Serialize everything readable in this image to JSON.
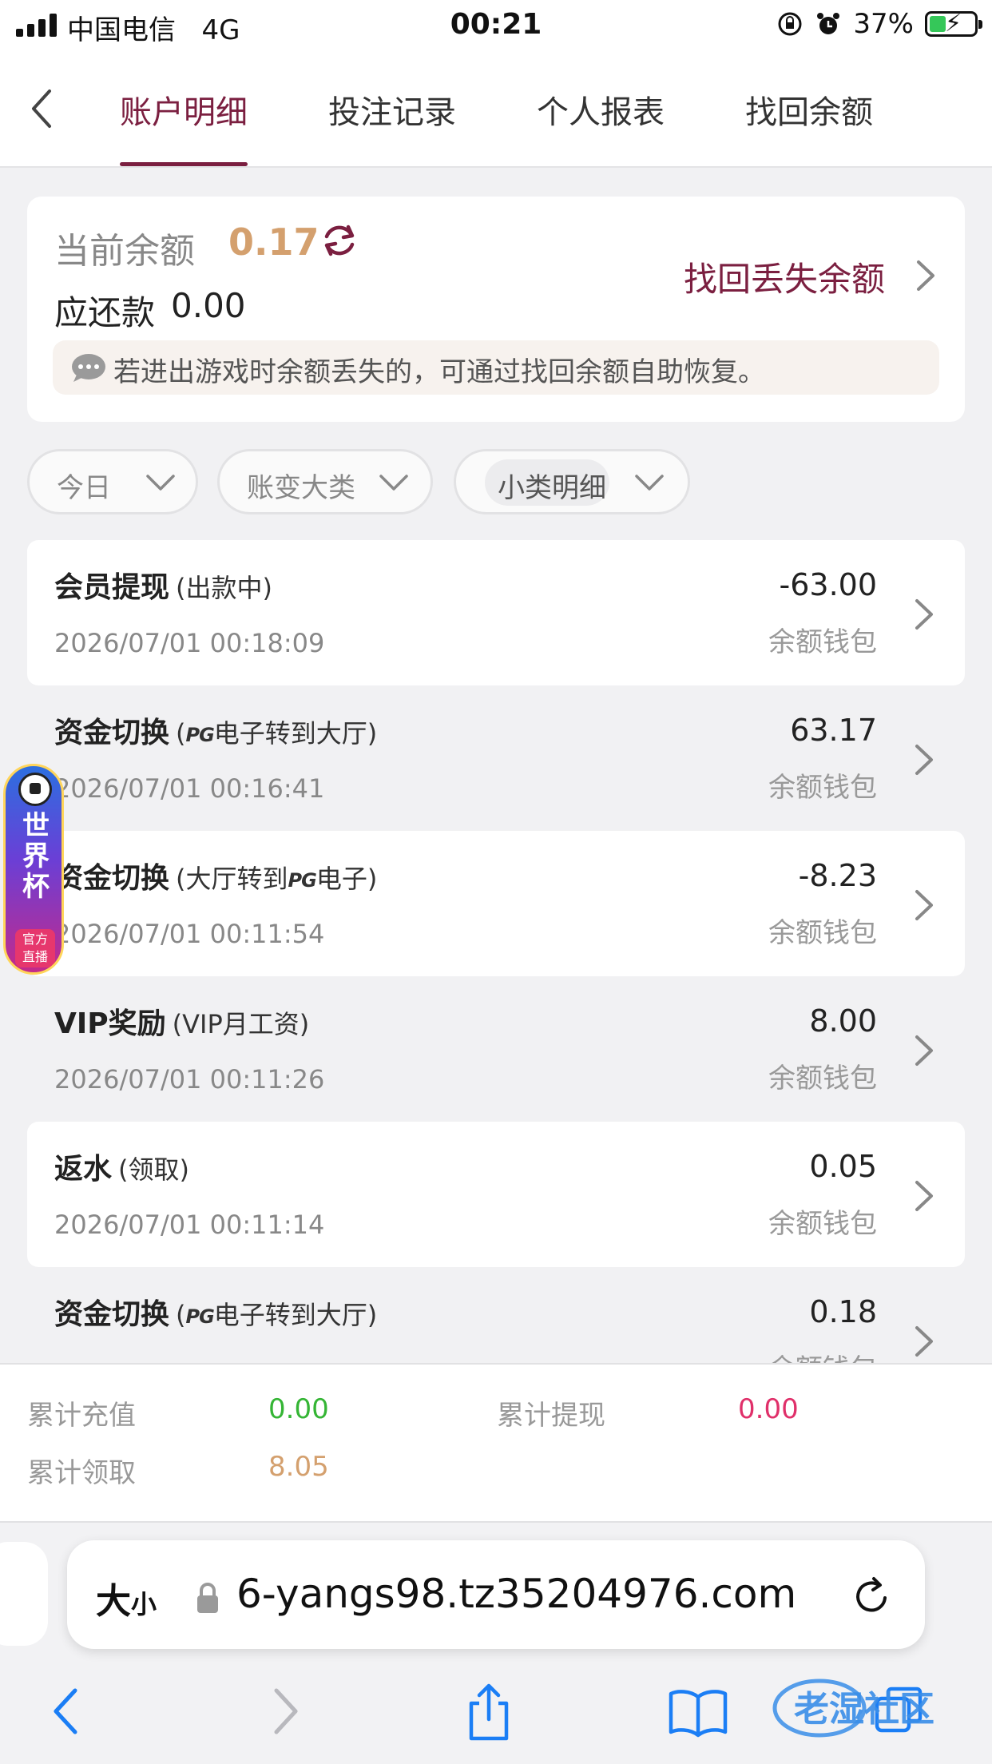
{
  "status_bar": {
    "carrier": "中国电信",
    "network": "4G",
    "time": "00:21",
    "battery": "37%",
    "battery_level": 0.37
  },
  "nav": {
    "tabs": [
      {
        "label": "账户明细",
        "active": true
      },
      {
        "label": "投注记录",
        "active": false
      },
      {
        "label": "个人报表",
        "active": false
      },
      {
        "label": "找回余额",
        "active": false
      }
    ]
  },
  "balance": {
    "label": "当前余额",
    "value": "0.17",
    "owe_label": "应还款",
    "owe_value": "0.00",
    "recover_link": "找回丢失余额",
    "tip": "若进出游戏时余额丢失的，可通过找回余额自助恢复。"
  },
  "filters": [
    {
      "label": "今日"
    },
    {
      "label": "账变大类"
    },
    {
      "label": "小类明细"
    }
  ],
  "records": [
    {
      "title": "会员提现",
      "sub": "(出款中)",
      "time": "2026/07/01 00:18:09",
      "amount": "-63.00",
      "wallet": "余额钱包"
    },
    {
      "title": "资金切换",
      "sub_pre": "(",
      "sub_pg": "PG",
      "sub_post": "电子转到大厅)",
      "time": "2026/07/01 00:16:41",
      "amount": "63.17",
      "wallet": "余额钱包"
    },
    {
      "title": "资金切换",
      "sub_pre": "(大厅转到",
      "sub_pg": "PG",
      "sub_post": "电子)",
      "time": "2026/07/01 00:11:54",
      "amount": "-8.23",
      "wallet": "余额钱包"
    },
    {
      "title": "VIP奖励",
      "sub": "(VIP月工资)",
      "time": "2026/07/01 00:11:26",
      "amount": "8.00",
      "wallet": "余额钱包"
    },
    {
      "title": "返水",
      "sub": "(领取)",
      "time": "2026/07/01 00:11:14",
      "amount": "0.05",
      "wallet": "余额钱包"
    },
    {
      "title": "资金切换",
      "sub_pre": "(",
      "sub_pg": "PG",
      "sub_post": "电子转到大厅)",
      "amount": "0.18",
      "wallet": "余额钱包"
    }
  ],
  "float_badge": {
    "text": "世界杯",
    "tag": "官方直播"
  },
  "summary": {
    "recharge_label": "累计充值",
    "recharge_value": "0.00",
    "withdraw_label": "累计提现",
    "withdraw_value": "0.00",
    "claim_label": "累计领取",
    "claim_value": "8.05"
  },
  "browser": {
    "text_size_label": "大",
    "text_size_small": "小",
    "url": "6-yangs98.tz35204976.com"
  },
  "watermark": "老湿社区",
  "colors": {
    "accent": "#7b1f40",
    "balance": "#d4a06e",
    "green": "#35b535",
    "pink": "#e0306a"
  }
}
